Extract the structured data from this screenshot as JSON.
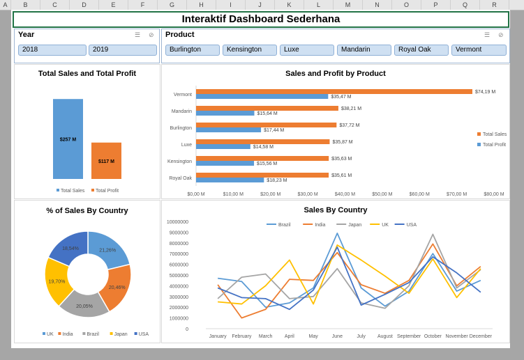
{
  "spreadsheet": {
    "columns": [
      "A",
      "B",
      "C",
      "D",
      "E",
      "F",
      "G",
      "H",
      "I",
      "J",
      "K",
      "L",
      "M",
      "N",
      "O",
      "P",
      "Q",
      "R"
    ]
  },
  "dashboard": {
    "title": "Interaktif Dashboard Sederhana"
  },
  "slicers": {
    "year": {
      "header": "Year",
      "items": [
        "2018",
        "2019"
      ]
    },
    "product": {
      "header": "Product",
      "items": [
        "Burlington",
        "Kensington",
        "Luxe",
        "Mandarin",
        "Royal Oak",
        "Vermont"
      ]
    }
  },
  "colors": {
    "sales": "#5b9bd5",
    "profit": "#ed7d31",
    "brazil": "#5b9bd5",
    "india": "#ed7d31",
    "japan": "#a5a5a5",
    "uk": "#ffc000",
    "usa": "#4472c4"
  },
  "chart_data": [
    {
      "id": "total",
      "type": "bar",
      "title": "Total Sales and  Total Profit",
      "categories": [
        "Total Sales",
        "Total Profit"
      ],
      "values": [
        257,
        117
      ],
      "value_labels": [
        "$257 M",
        "$117 M"
      ],
      "legend": [
        "Total Sales",
        "Total Profit"
      ],
      "legend_position": "bottom",
      "ylim": [
        0,
        300
      ]
    },
    {
      "id": "product",
      "type": "bar",
      "orientation": "horizontal",
      "title": "Sales and Profit by Product",
      "categories": [
        "Vermont",
        "Mandarin",
        "Burlington",
        "Luxe",
        "Kensington",
        "Royal Oak"
      ],
      "series": [
        {
          "name": "Total  Sales",
          "values": [
            74.19,
            38.21,
            37.72,
            35.87,
            35.63,
            35.61
          ],
          "labels": [
            "$74,19 M",
            "$38,21 M",
            "$37,72 M",
            "$35,87 M",
            "$35,63 M",
            "$35,61 M"
          ]
        },
        {
          "name": "Total Profit",
          "values": [
            35.47,
            15.64,
            17.44,
            14.58,
            15.56,
            18.23
          ],
          "labels": [
            "$35,47 M",
            "$15,64 M",
            "$17,44 M",
            "$14,58 M",
            "$15,56 M",
            "$18,23 M"
          ]
        }
      ],
      "xticks": [
        "$0,00 M",
        "$10,00 M",
        "$20,00 M",
        "$30,00 M",
        "$40,00 M",
        "$50,00 M",
        "$60,00 M",
        "$70,00 M",
        "$80,00 M"
      ],
      "xlim": [
        0,
        80
      ],
      "legend_position": "right"
    },
    {
      "id": "country_pct",
      "type": "pie",
      "style": "doughnut",
      "title": "% of Sales By Country",
      "categories": [
        "UK",
        "India",
        "Brazil",
        "Japan",
        "USA"
      ],
      "values": [
        21.26,
        20.46,
        20.05,
        19.7,
        18.54
      ],
      "slice_order": [
        "Brazil",
        "India",
        "Japan",
        "UK",
        "USA"
      ],
      "slice_values": [
        21.26,
        20.46,
        20.05,
        19.7,
        18.54
      ],
      "slice_labels": [
        "21,26%",
        "20,46%",
        "20,05%",
        "19,70%",
        "18,54%"
      ],
      "legend": [
        "UK",
        "India",
        "Brazil",
        "Japan",
        "USA"
      ],
      "legend_position": "bottom"
    },
    {
      "id": "country_month",
      "type": "line",
      "title": "Sales By Country",
      "x": [
        "January",
        "February",
        "March",
        "April",
        "May",
        "June",
        "July",
        "August",
        "September",
        "October",
        "November",
        "December"
      ],
      "yticks": [
        "0",
        "1000000",
        "2000000",
        "3000000",
        "4000000",
        "5000000",
        "6000000",
        "7000000",
        "8000000",
        "9000000",
        "10000000"
      ],
      "ylim": [
        0,
        10000000
      ],
      "legend_position": "top",
      "series": [
        {
          "name": "Brazil",
          "values": [
            4700000,
            4400000,
            2000000,
            2400000,
            3800000,
            8900000,
            3800000,
            2100000,
            3500000,
            7000000,
            3500000,
            4500000
          ]
        },
        {
          "name": "India",
          "values": [
            4100000,
            1000000,
            1800000,
            4600000,
            4500000,
            7100000,
            4100000,
            3300000,
            4500000,
            7900000,
            4000000,
            5800000
          ]
        },
        {
          "name": "Japan",
          "values": [
            2800000,
            4800000,
            5100000,
            2800000,
            3000000,
            5600000,
            2400000,
            1900000,
            4000000,
            8800000,
            3800000,
            5500000
          ]
        },
        {
          "name": "UK",
          "values": [
            2500000,
            2300000,
            4000000,
            6400000,
            2300000,
            7800000,
            6400000,
            4900000,
            3300000,
            6500000,
            2900000,
            5600000
          ]
        },
        {
          "name": "USA",
          "values": [
            3800000,
            2900000,
            2800000,
            1800000,
            3600000,
            7600000,
            2200000,
            3200000,
            4300000,
            6700000,
            5200000,
            3400000
          ]
        }
      ]
    }
  ]
}
